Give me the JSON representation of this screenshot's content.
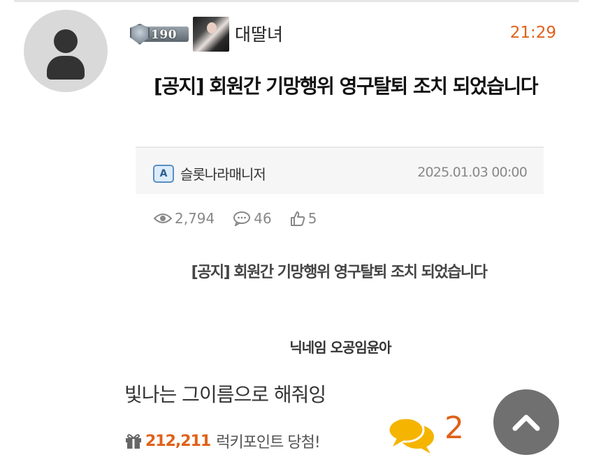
{
  "post": {
    "level": "190",
    "nickname": "대딸녀",
    "time": "21:29",
    "title": "[공지] 회원간 기망행위 영구탈퇴 조치 되었습니다",
    "author": "슬롯나라매니저",
    "date": "2025.01.03 00:00",
    "views": "2,794",
    "comments": "46",
    "likes": "5"
  },
  "content": {
    "notice_line": "[공지] 회원간 기망행위 영구탈퇴 조치 되었습니다",
    "nick_line": "닉네임 오공임윤아",
    "comment_text": "빛나는 그이름으로 해줘잉"
  },
  "footer": {
    "lucky_points": "212,211",
    "lucky_label": "럭키포인트 당첨!",
    "comment_count": "2"
  },
  "colors": {
    "accent": "#e0611a",
    "bubble": "#f5b400",
    "scroll_button": "#707070"
  },
  "icons": [
    "user-icon",
    "level-shield-icon",
    "author-badge-icon",
    "eye-icon",
    "comment-icon",
    "thumbs-up-icon",
    "gift-icon",
    "speech-bubbles-icon",
    "chevron-up-icon"
  ]
}
